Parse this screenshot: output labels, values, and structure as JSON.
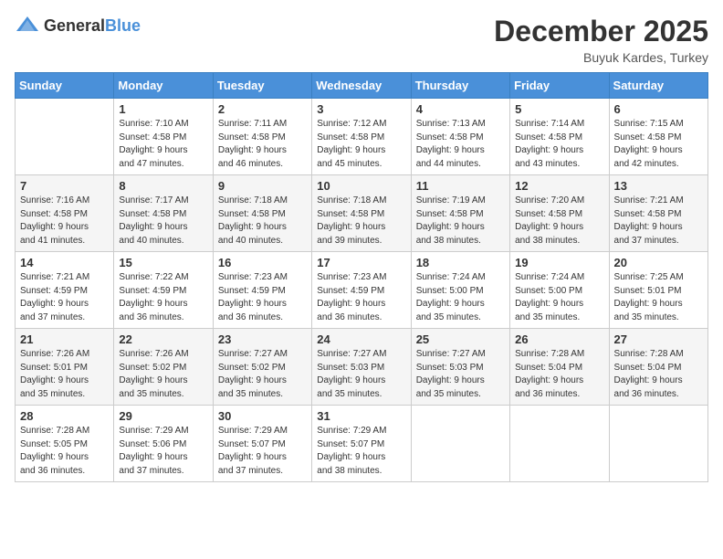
{
  "header": {
    "logo": {
      "text_general": "General",
      "text_blue": "Blue"
    },
    "month_title": "December 2025",
    "location": "Buyuk Kardes, Turkey"
  },
  "days_of_week": [
    "Sunday",
    "Monday",
    "Tuesday",
    "Wednesday",
    "Thursday",
    "Friday",
    "Saturday"
  ],
  "weeks": [
    [
      {
        "day": "",
        "info": ""
      },
      {
        "day": "1",
        "info": "Sunrise: 7:10 AM\nSunset: 4:58 PM\nDaylight: 9 hours\nand 47 minutes."
      },
      {
        "day": "2",
        "info": "Sunrise: 7:11 AM\nSunset: 4:58 PM\nDaylight: 9 hours\nand 46 minutes."
      },
      {
        "day": "3",
        "info": "Sunrise: 7:12 AM\nSunset: 4:58 PM\nDaylight: 9 hours\nand 45 minutes."
      },
      {
        "day": "4",
        "info": "Sunrise: 7:13 AM\nSunset: 4:58 PM\nDaylight: 9 hours\nand 44 minutes."
      },
      {
        "day": "5",
        "info": "Sunrise: 7:14 AM\nSunset: 4:58 PM\nDaylight: 9 hours\nand 43 minutes."
      },
      {
        "day": "6",
        "info": "Sunrise: 7:15 AM\nSunset: 4:58 PM\nDaylight: 9 hours\nand 42 minutes."
      }
    ],
    [
      {
        "day": "7",
        "info": "Sunrise: 7:16 AM\nSunset: 4:58 PM\nDaylight: 9 hours\nand 41 minutes."
      },
      {
        "day": "8",
        "info": "Sunrise: 7:17 AM\nSunset: 4:58 PM\nDaylight: 9 hours\nand 40 minutes."
      },
      {
        "day": "9",
        "info": "Sunrise: 7:18 AM\nSunset: 4:58 PM\nDaylight: 9 hours\nand 40 minutes."
      },
      {
        "day": "10",
        "info": "Sunrise: 7:18 AM\nSunset: 4:58 PM\nDaylight: 9 hours\nand 39 minutes."
      },
      {
        "day": "11",
        "info": "Sunrise: 7:19 AM\nSunset: 4:58 PM\nDaylight: 9 hours\nand 38 minutes."
      },
      {
        "day": "12",
        "info": "Sunrise: 7:20 AM\nSunset: 4:58 PM\nDaylight: 9 hours\nand 38 minutes."
      },
      {
        "day": "13",
        "info": "Sunrise: 7:21 AM\nSunset: 4:58 PM\nDaylight: 9 hours\nand 37 minutes."
      }
    ],
    [
      {
        "day": "14",
        "info": "Sunrise: 7:21 AM\nSunset: 4:59 PM\nDaylight: 9 hours\nand 37 minutes."
      },
      {
        "day": "15",
        "info": "Sunrise: 7:22 AM\nSunset: 4:59 PM\nDaylight: 9 hours\nand 36 minutes."
      },
      {
        "day": "16",
        "info": "Sunrise: 7:23 AM\nSunset: 4:59 PM\nDaylight: 9 hours\nand 36 minutes."
      },
      {
        "day": "17",
        "info": "Sunrise: 7:23 AM\nSunset: 4:59 PM\nDaylight: 9 hours\nand 36 minutes."
      },
      {
        "day": "18",
        "info": "Sunrise: 7:24 AM\nSunset: 5:00 PM\nDaylight: 9 hours\nand 35 minutes."
      },
      {
        "day": "19",
        "info": "Sunrise: 7:24 AM\nSunset: 5:00 PM\nDaylight: 9 hours\nand 35 minutes."
      },
      {
        "day": "20",
        "info": "Sunrise: 7:25 AM\nSunset: 5:01 PM\nDaylight: 9 hours\nand 35 minutes."
      }
    ],
    [
      {
        "day": "21",
        "info": "Sunrise: 7:26 AM\nSunset: 5:01 PM\nDaylight: 9 hours\nand 35 minutes."
      },
      {
        "day": "22",
        "info": "Sunrise: 7:26 AM\nSunset: 5:02 PM\nDaylight: 9 hours\nand 35 minutes."
      },
      {
        "day": "23",
        "info": "Sunrise: 7:27 AM\nSunset: 5:02 PM\nDaylight: 9 hours\nand 35 minutes."
      },
      {
        "day": "24",
        "info": "Sunrise: 7:27 AM\nSunset: 5:03 PM\nDaylight: 9 hours\nand 35 minutes."
      },
      {
        "day": "25",
        "info": "Sunrise: 7:27 AM\nSunset: 5:03 PM\nDaylight: 9 hours\nand 35 minutes."
      },
      {
        "day": "26",
        "info": "Sunrise: 7:28 AM\nSunset: 5:04 PM\nDaylight: 9 hours\nand 36 minutes."
      },
      {
        "day": "27",
        "info": "Sunrise: 7:28 AM\nSunset: 5:04 PM\nDaylight: 9 hours\nand 36 minutes."
      }
    ],
    [
      {
        "day": "28",
        "info": "Sunrise: 7:28 AM\nSunset: 5:05 PM\nDaylight: 9 hours\nand 36 minutes."
      },
      {
        "day": "29",
        "info": "Sunrise: 7:29 AM\nSunset: 5:06 PM\nDaylight: 9 hours\nand 37 minutes."
      },
      {
        "day": "30",
        "info": "Sunrise: 7:29 AM\nSunset: 5:07 PM\nDaylight: 9 hours\nand 37 minutes."
      },
      {
        "day": "31",
        "info": "Sunrise: 7:29 AM\nSunset: 5:07 PM\nDaylight: 9 hours\nand 38 minutes."
      },
      {
        "day": "",
        "info": ""
      },
      {
        "day": "",
        "info": ""
      },
      {
        "day": "",
        "info": ""
      }
    ]
  ]
}
